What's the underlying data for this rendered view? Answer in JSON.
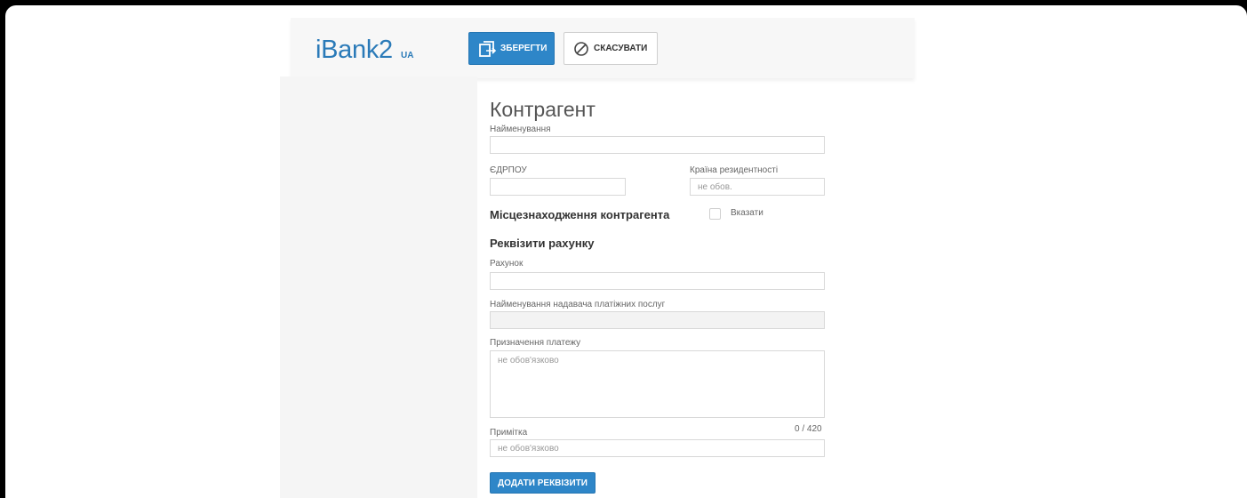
{
  "header": {
    "logo_text": "iBank2",
    "logo_sub": "UA",
    "save_label": "ЗБЕРЕГТИ",
    "cancel_label": "СКАСУВАТИ"
  },
  "form": {
    "title": "Контрагент",
    "name_label": "Найменування",
    "name_value": "",
    "edrpou_label": "ЄДРПОУ",
    "edrpou_value": "",
    "country_label": "Країна резидентності",
    "country_placeholder": "не обов.",
    "location_heading": "Місцезнаходження контрагента",
    "specify_label": "Вказати",
    "specify_checked": false,
    "requisites_heading": "Реквізити рахунку",
    "account_label": "Рахунок",
    "account_value": "",
    "provider_label": "Найменування надавача платіжних послуг",
    "provider_value": "",
    "purpose_label": "Призначення платежу",
    "purpose_placeholder": "не обов'язково",
    "purpose_counter": "0 / 420",
    "note_label": "Примітка",
    "note_placeholder": "не обов'язково",
    "add_button_label": "ДОДАТИ РЕКВІЗИТИ"
  },
  "colors": {
    "accent": "#2e86c8",
    "logo": "#2a7ab8"
  }
}
